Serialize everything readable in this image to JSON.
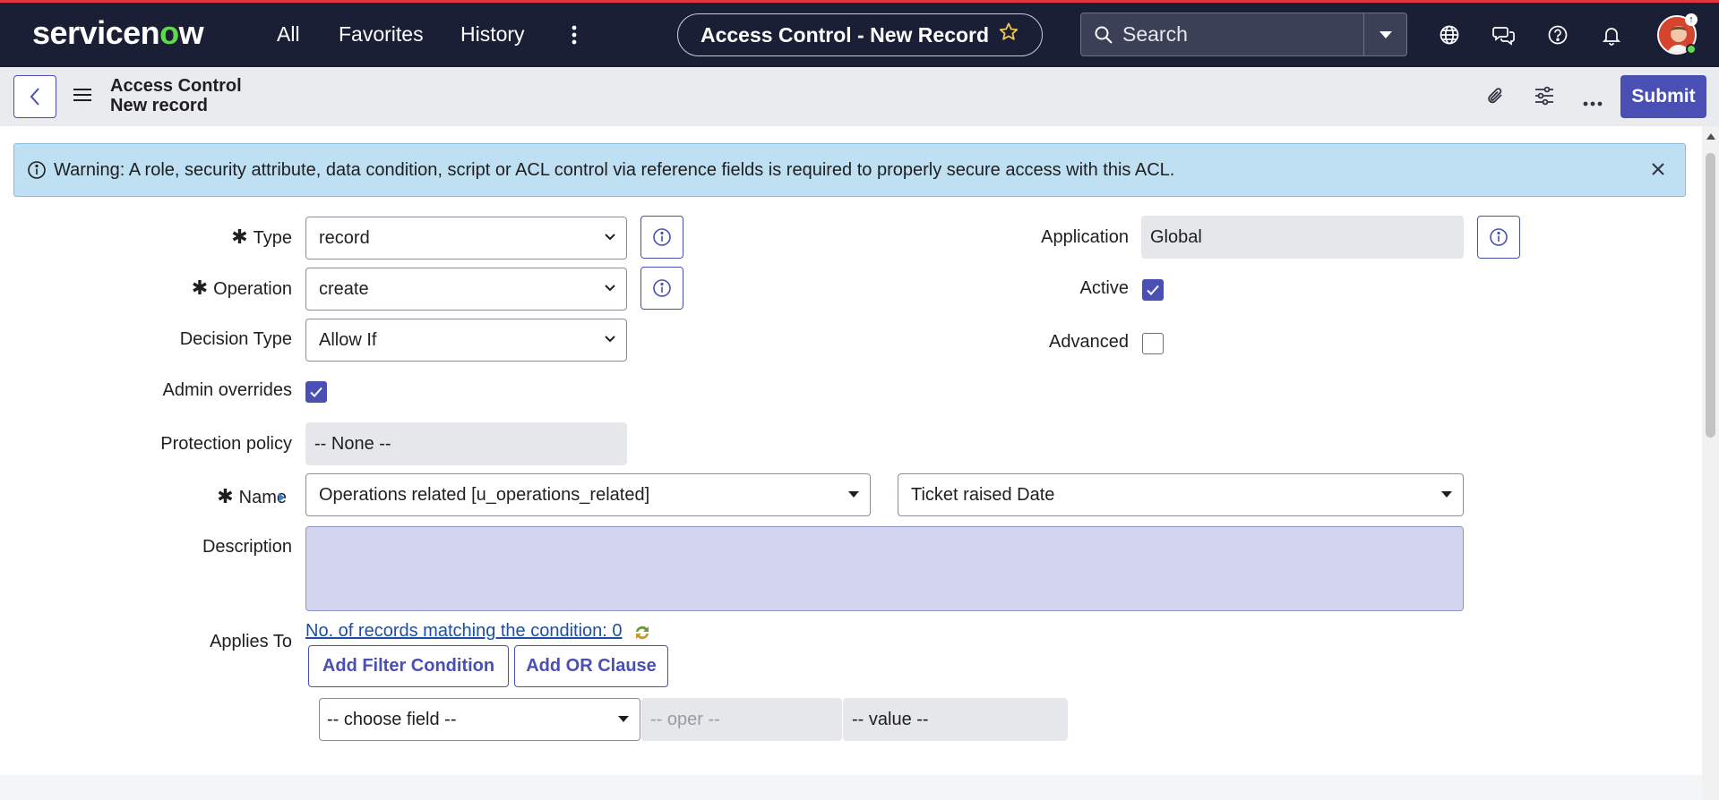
{
  "nav": {
    "logo": "servicenow",
    "all": "All",
    "favorites": "Favorites",
    "history": "History",
    "record_title": "Access Control - New Record",
    "search_placeholder": "Search"
  },
  "header": {
    "title_line1": "Access Control",
    "title_line2": "New record",
    "submit": "Submit"
  },
  "warning": {
    "text": "Warning: A role, security attribute, data condition, script or ACL control via reference fields is required to properly secure access with this ACL."
  },
  "form": {
    "type_label": "Type",
    "type_value": "record",
    "operation_label": "Operation",
    "operation_value": "create",
    "decision_type_label": "Decision Type",
    "decision_type_value": "Allow If",
    "admin_overrides_label": "Admin overrides",
    "admin_overrides_checked": true,
    "protection_policy_label": "Protection policy",
    "protection_policy_value": "-- None --",
    "name_label": "Name",
    "name_table_value": "Operations related [u_operations_related]",
    "name_field_value": "Ticket raised Date",
    "description_label": "Description",
    "description_value": "",
    "application_label": "Application",
    "application_value": "Global",
    "active_label": "Active",
    "active_checked": true,
    "advanced_label": "Advanced",
    "advanced_checked": false,
    "applies_to_label": "Applies To",
    "records_link": "No. of records matching the condition: 0",
    "add_filter_button": "Add Filter Condition",
    "add_or_button": "Add OR Clause",
    "choose_field": "-- choose field --",
    "oper_placeholder": "-- oper --",
    "value_placeholder": "-- value --"
  },
  "colors": {
    "nav_bg": "#1a1f36",
    "accent": "#4a4fb3",
    "warning_bg": "#bfdff3",
    "brand_green": "#62d84e"
  }
}
